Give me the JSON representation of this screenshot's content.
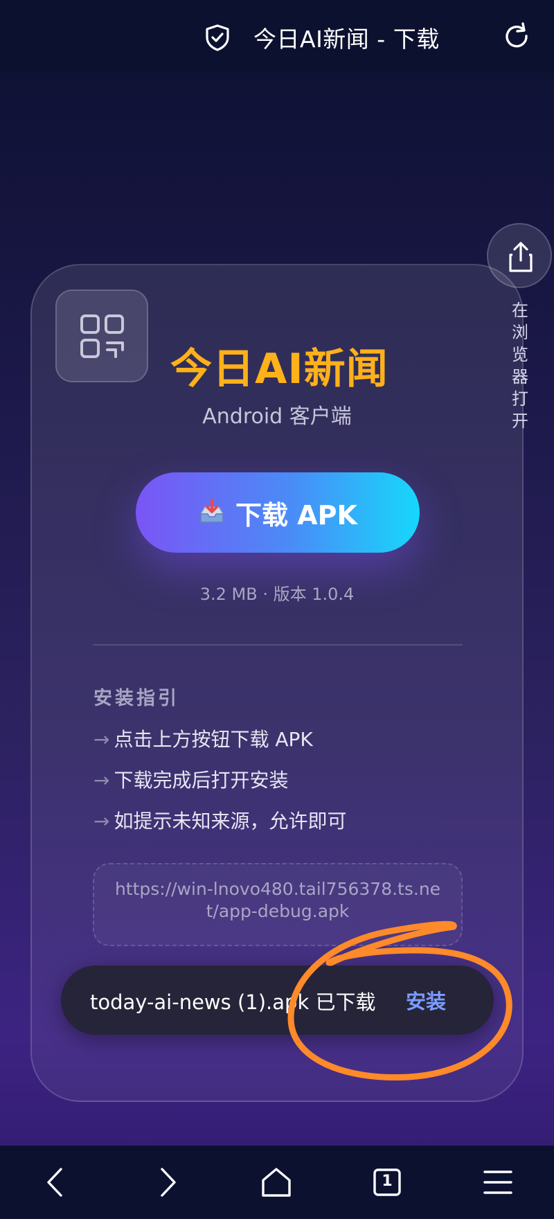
{
  "browser": {
    "tab_title": "今日AI新闻 - 下载",
    "icons": {
      "shield": "shield-check-icon",
      "reload": "reload-icon"
    }
  },
  "side_action": {
    "icon": "share-upload-icon",
    "label": "在浏览器打开"
  },
  "card": {
    "app_icon": "app-grid-icon",
    "app_name": "今日AI新闻",
    "subtitle": "Android 客户端",
    "download_button": {
      "icon": "inbox-tray-icon",
      "label": "下载 APK"
    },
    "meta": "3.2 MB · 版本 1.0.4",
    "guide": {
      "title": "安装指引",
      "arrow": "→",
      "items": [
        "点击上方按钮下载 APK",
        "下载完成后打开安装",
        "如提示未知来源，允许即可"
      ]
    },
    "url": "https://win-lnovo480.tail756378.ts.net/app-debug.apk"
  },
  "toast": {
    "message": "today-ai-news (1).apk 已下载",
    "action": "安装"
  },
  "bottom_nav": {
    "tab_count": "1",
    "icons": [
      "back-icon",
      "forward-icon",
      "home-icon",
      "tabs-icon",
      "menu-icon"
    ]
  },
  "colors": {
    "accent_title": "#ffb11a",
    "button_gradient_start": "#7a55f5",
    "button_gradient_end": "#16d8fb",
    "toast_action": "#7b9dff",
    "annotation": "#ff8a2a"
  }
}
